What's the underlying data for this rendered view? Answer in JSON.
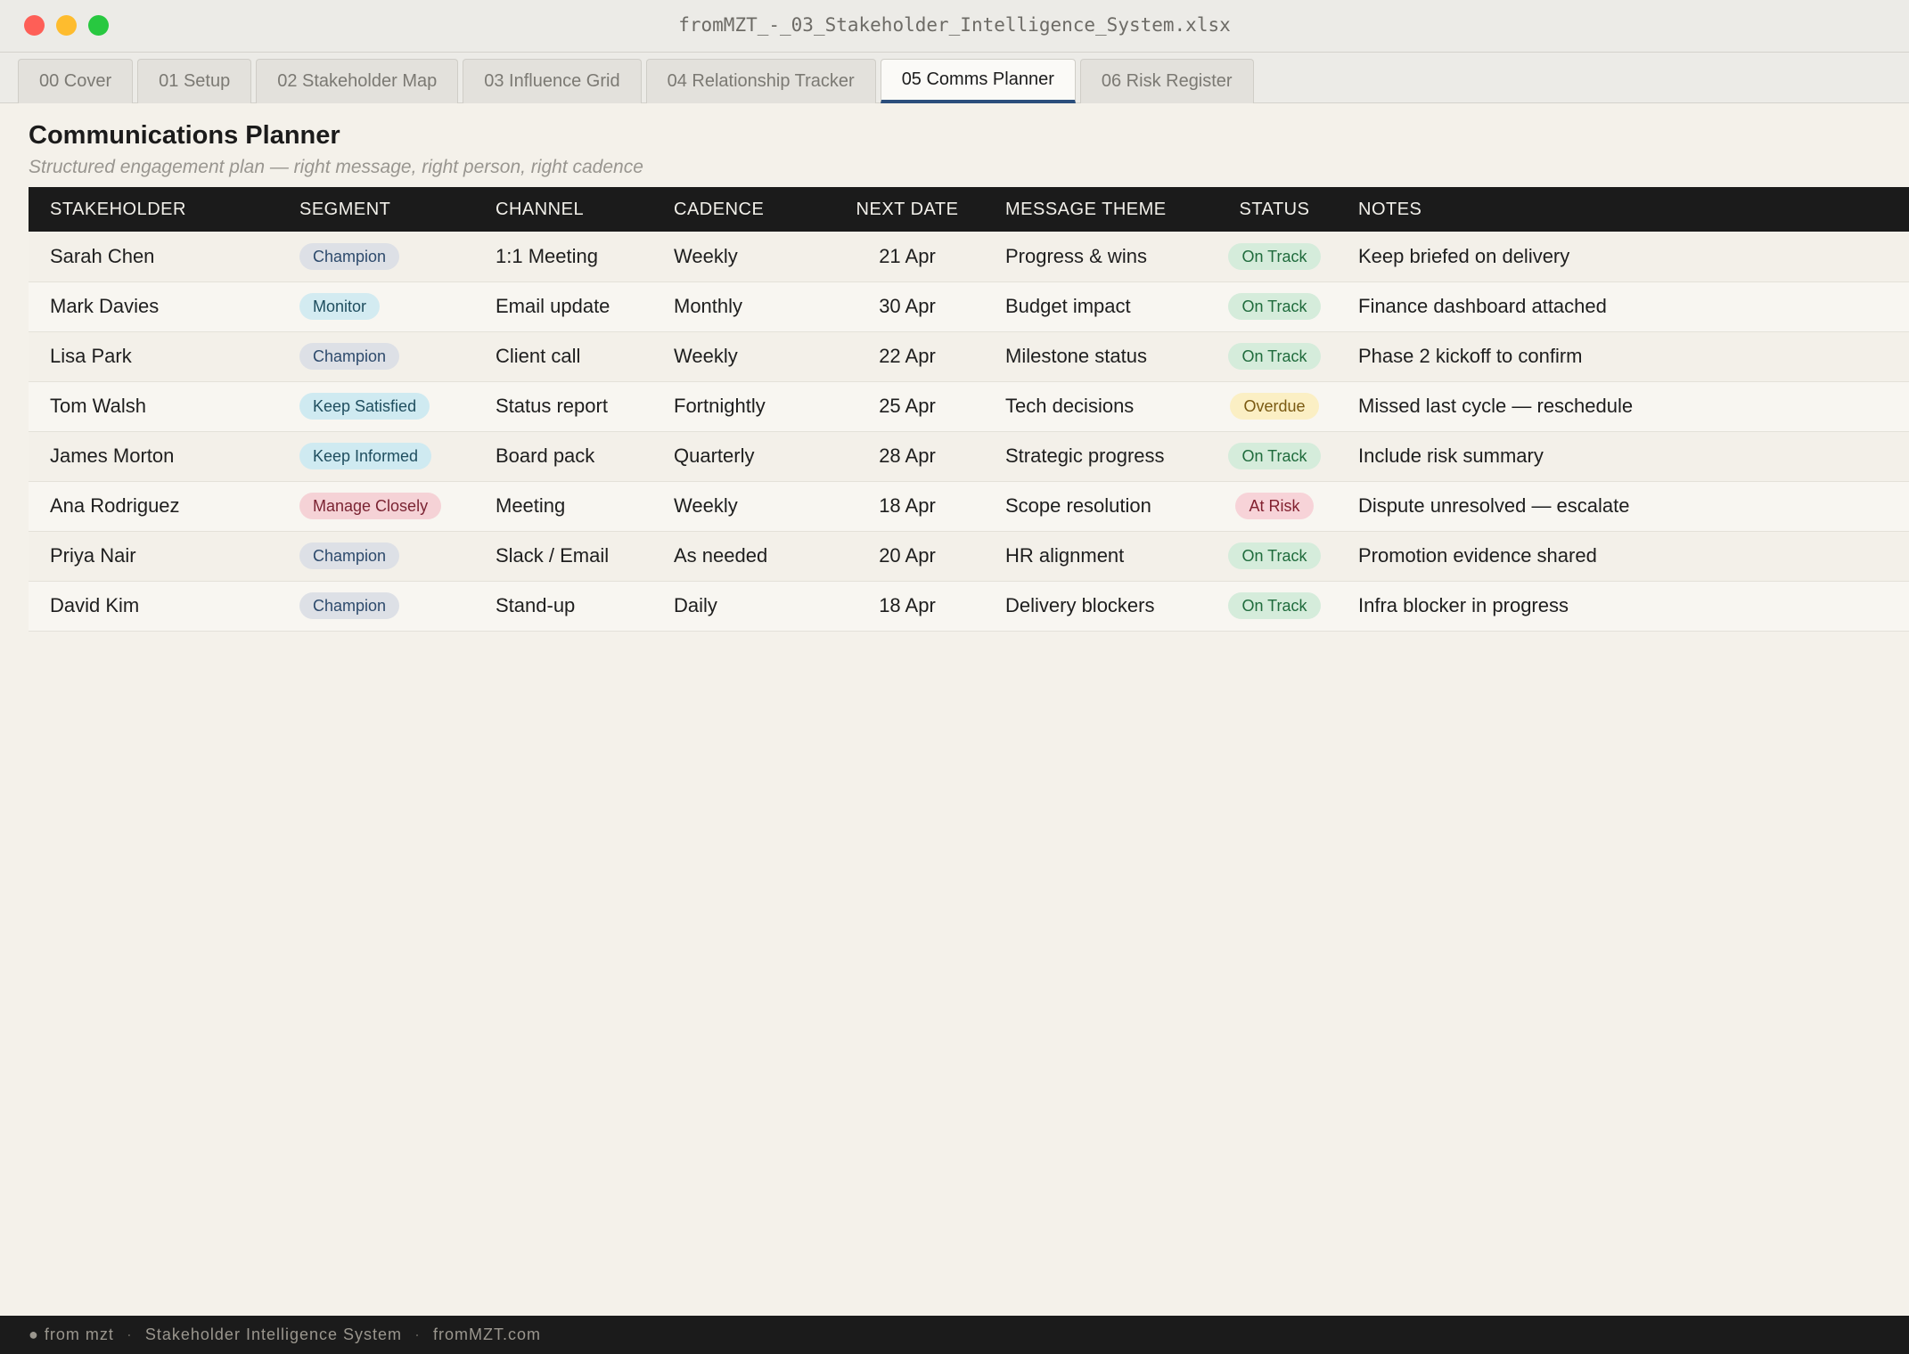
{
  "window": {
    "title": "fromMZT_-_03_Stakeholder_Intelligence_System.xlsx"
  },
  "tabs": [
    {
      "label": "00 Cover",
      "active": false
    },
    {
      "label": "01 Setup",
      "active": false
    },
    {
      "label": "02 Stakeholder Map",
      "active": false
    },
    {
      "label": "03 Influence Grid",
      "active": false
    },
    {
      "label": "04 Relationship Tracker",
      "active": false
    },
    {
      "label": "05 Comms Planner",
      "active": true
    },
    {
      "label": "06 Risk Register",
      "active": false
    }
  ],
  "page": {
    "title": "Communications Planner",
    "subtitle": "Structured engagement plan — right message, right person, right cadence"
  },
  "table": {
    "headers": [
      "STAKEHOLDER",
      "SEGMENT",
      "CHANNEL",
      "CADENCE",
      "NEXT DATE",
      "MESSAGE THEME",
      "STATUS",
      "NOTES"
    ],
    "rows": [
      {
        "stakeholder": "Sarah Chen",
        "segment": "Champion",
        "channel": "1:1 Meeting",
        "cadence": "Weekly",
        "next_date": "21 Apr",
        "theme": "Progress & wins",
        "status": "On Track",
        "notes": "Keep briefed on delivery"
      },
      {
        "stakeholder": "Mark Davies",
        "segment": "Monitor",
        "channel": "Email update",
        "cadence": "Monthly",
        "next_date": "30 Apr",
        "theme": "Budget impact",
        "status": "On Track",
        "notes": "Finance dashboard attached"
      },
      {
        "stakeholder": "Lisa Park",
        "segment": "Champion",
        "channel": "Client call",
        "cadence": "Weekly",
        "next_date": "22 Apr",
        "theme": "Milestone status",
        "status": "On Track",
        "notes": "Phase 2 kickoff to confirm"
      },
      {
        "stakeholder": "Tom Walsh",
        "segment": "Keep Satisfied",
        "channel": "Status report",
        "cadence": "Fortnightly",
        "next_date": "25 Apr",
        "theme": "Tech decisions",
        "status": "Overdue",
        "notes": "Missed last cycle — reschedule"
      },
      {
        "stakeholder": "James Morton",
        "segment": "Keep Informed",
        "channel": "Board pack",
        "cadence": "Quarterly",
        "next_date": "28 Apr",
        "theme": "Strategic progress",
        "status": "On Track",
        "notes": "Include risk summary"
      },
      {
        "stakeholder": "Ana Rodriguez",
        "segment": "Manage Closely",
        "channel": "Meeting",
        "cadence": "Weekly",
        "next_date": "18 Apr",
        "theme": "Scope resolution",
        "status": "At Risk",
        "notes": "Dispute unresolved — escalate"
      },
      {
        "stakeholder": "Priya Nair",
        "segment": "Champion",
        "channel": "Slack / Email",
        "cadence": "As needed",
        "next_date": "20 Apr",
        "theme": "HR alignment",
        "status": "On Track",
        "notes": "Promotion evidence shared"
      },
      {
        "stakeholder": "David Kim",
        "segment": "Champion",
        "channel": "Stand-up",
        "cadence": "Daily",
        "next_date": "18 Apr",
        "theme": "Delivery blockers",
        "status": "On Track",
        "notes": "Infra blocker in progress"
      }
    ]
  },
  "footer": {
    "brand": "● from mzt",
    "product": "Stakeholder Intelligence System",
    "site": "fromMZT.com",
    "separator": "·"
  },
  "colors": {
    "header_bg": "#1b1b1b",
    "active_tab_underline": "#2b4e7c",
    "on_track": "#d5ecdb",
    "overdue": "#fbefc4",
    "at_risk": "#f7d3d8"
  }
}
